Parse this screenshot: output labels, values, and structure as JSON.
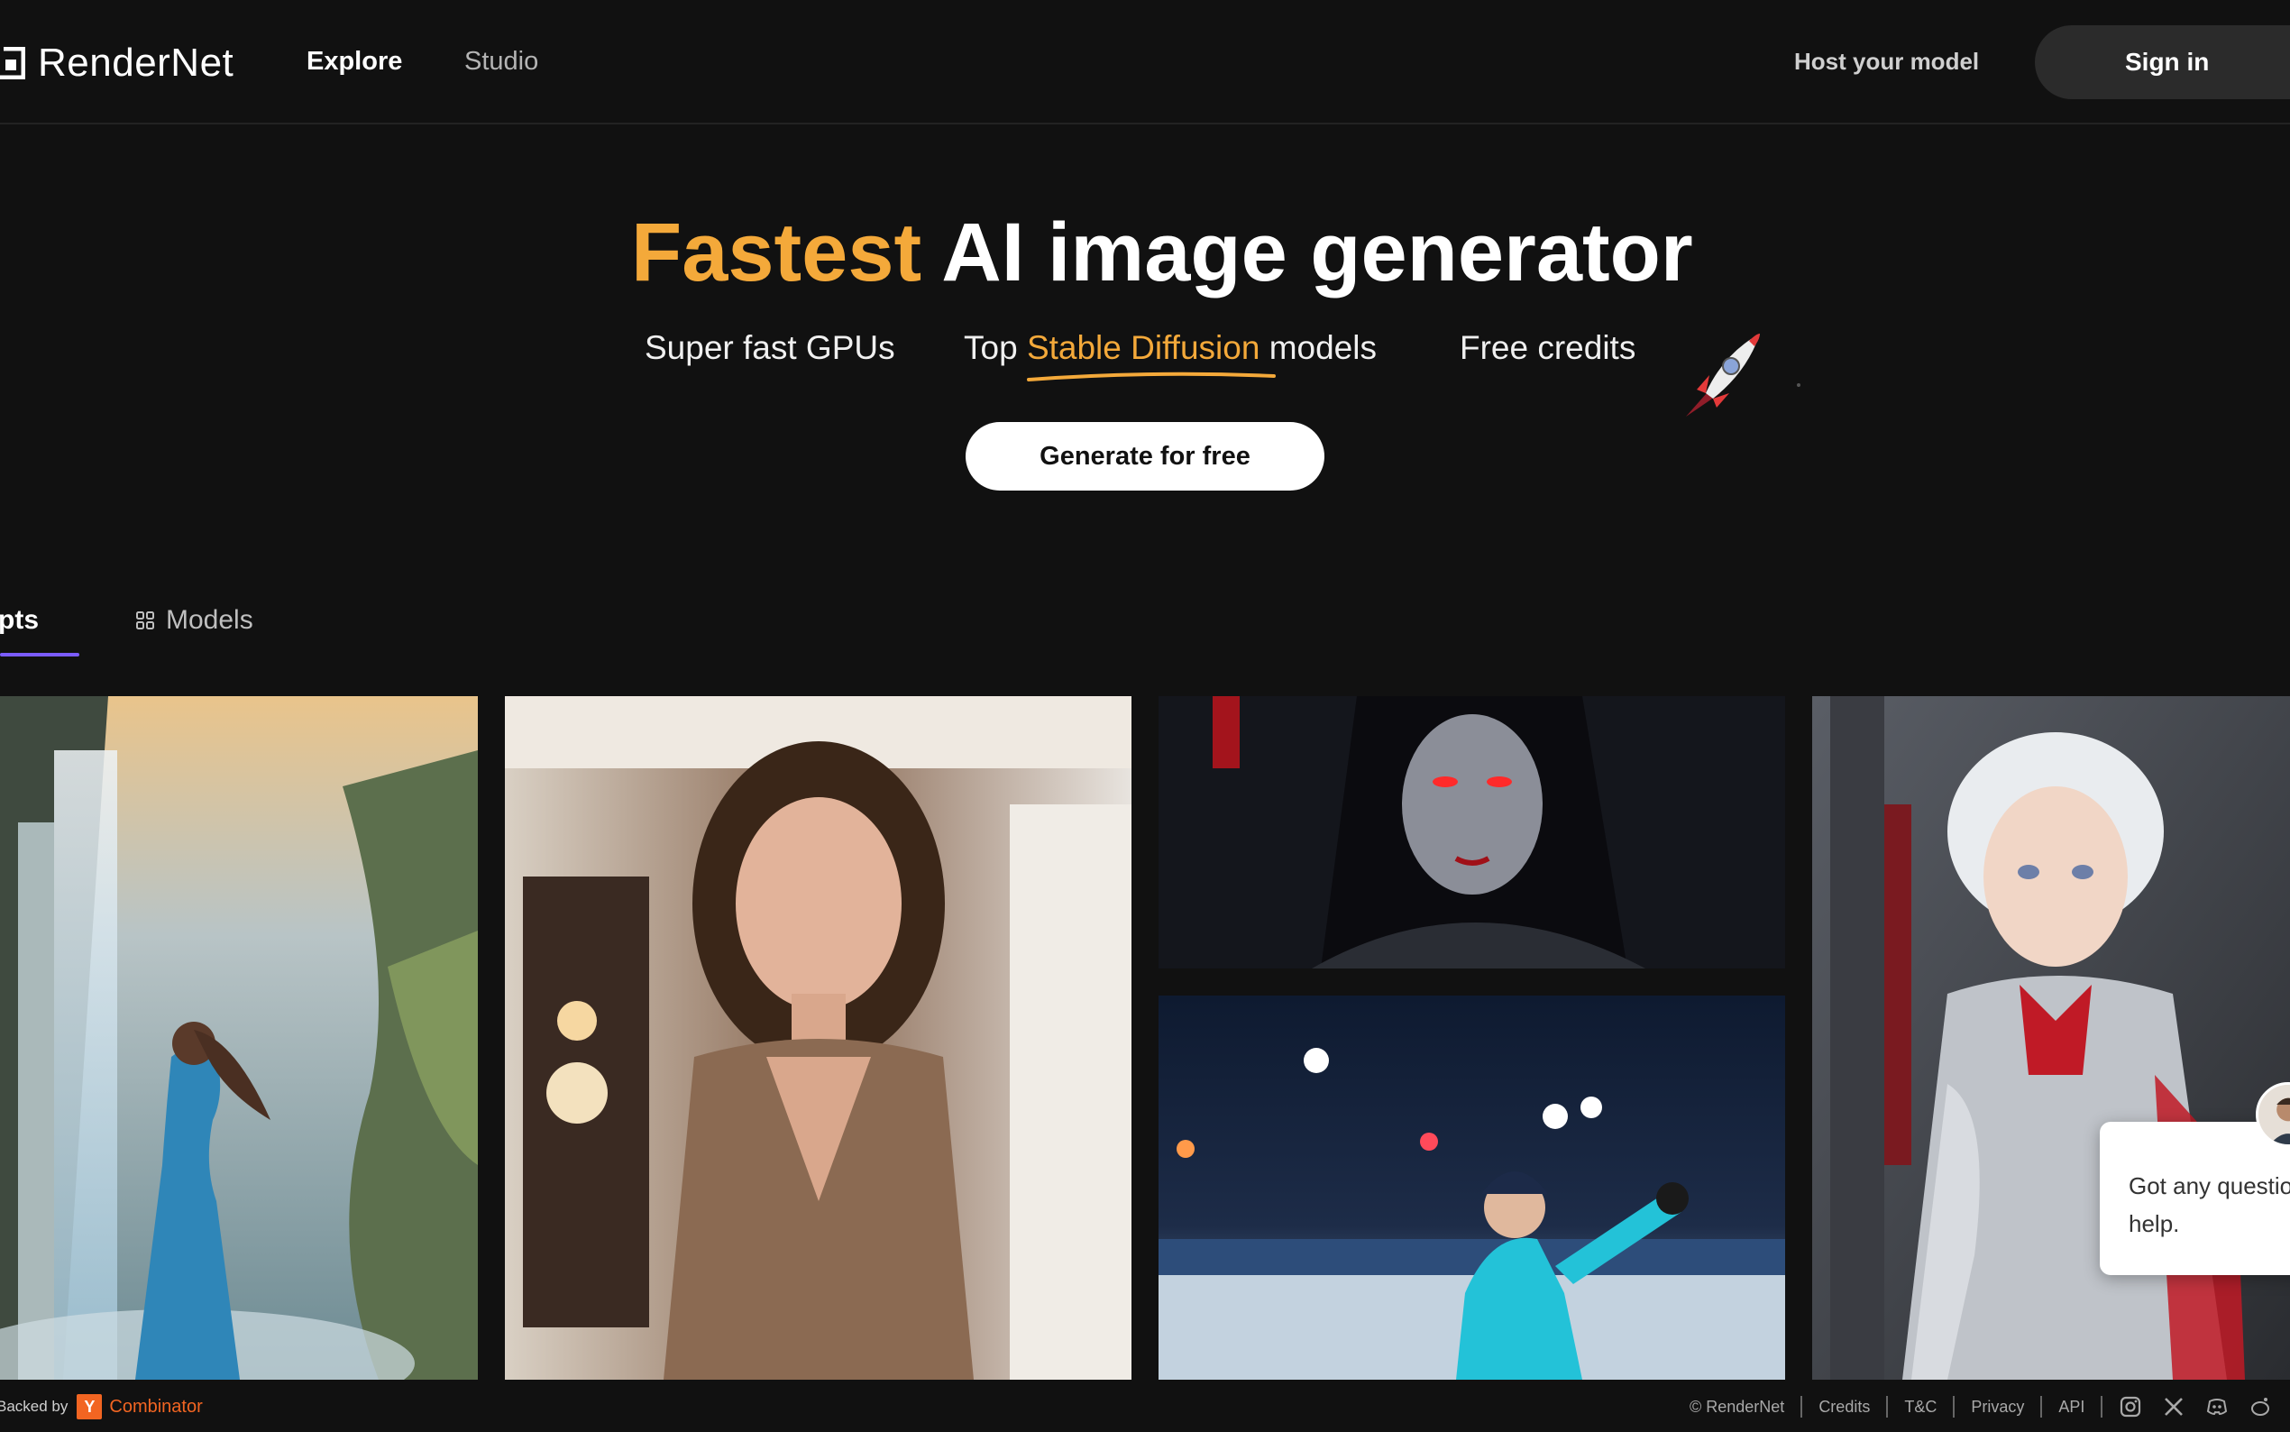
{
  "header": {
    "brand": "RenderNet",
    "nav": {
      "explore": "Explore",
      "studio": "Studio"
    },
    "host_link": "Host your model",
    "signin": "Sign in"
  },
  "hero": {
    "title_accent": "Fastest",
    "title_rest": "AI image generator",
    "features": {
      "f1": "Super fast GPUs",
      "f2_pre": "Top ",
      "f2_hl": "Stable Diffusion",
      "f2_post": " models",
      "f3": "Free credits"
    },
    "cta": "Generate for free"
  },
  "tabs": {
    "prompts": "pts",
    "models": "Models"
  },
  "chat": {
    "line1": "Got any questio",
    "line2": "help."
  },
  "footer": {
    "backed_by": "Backed by",
    "yc_letter": "Y",
    "yc_name": "Combinator",
    "copyright": "© RenderNet",
    "links": [
      "Credits",
      "T&C",
      "Privacy",
      "API"
    ]
  },
  "colors": {
    "accent": "#f4a93a",
    "background": "#111111",
    "tab_indicator": "#7b5cff",
    "yc_orange": "#f26522"
  }
}
